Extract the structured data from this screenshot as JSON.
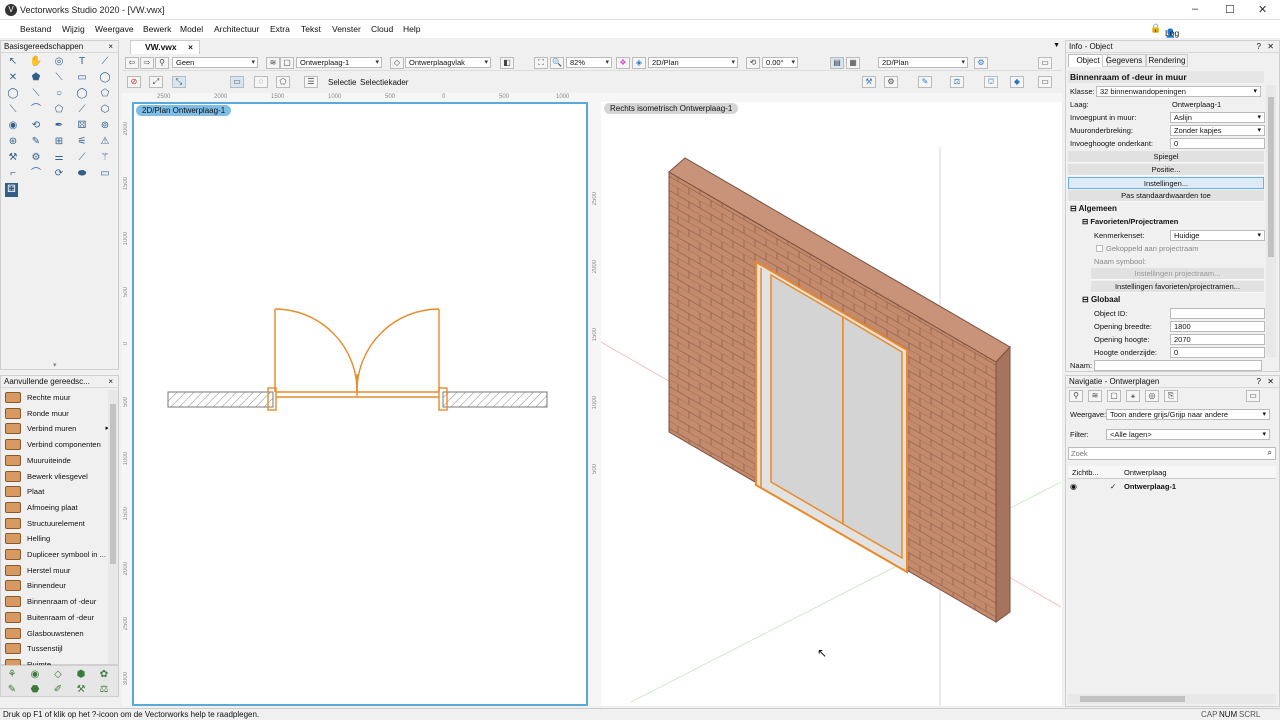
{
  "window": {
    "title": "Vectorworks Studio 2020 - [VW.vwx]",
    "app_icon": "V"
  },
  "menu": [
    "Bestand",
    "Wijzig",
    "Weergave",
    "Bewerk",
    "Model",
    "Architectuur",
    "Extra",
    "Tekst",
    "Venster",
    "Cloud",
    "Help"
  ],
  "login": "Log in",
  "tab": {
    "name": "VW.vwx",
    "close": "×"
  },
  "palette_basic": {
    "title": "Basisgereedschappen",
    "close": "×"
  },
  "palette_extra": {
    "title": "Aanvullende gereedsc...",
    "close": "×",
    "items": [
      "Rechte muur",
      "Ronde muur",
      "Verbind muren",
      "Verbind componenten",
      "Muuruiteinde",
      "Bewerk vliesgevel",
      "Plaat",
      "Afmoeing plaat",
      "Structuurelement",
      "Helling",
      "Dupliceer symbool in ...",
      "Herstel muur",
      "Binnendeur",
      "Binnenraam of -deur",
      "Buitenraam of -deur",
      "Glasbouwstenen",
      "Tussenstijl",
      "Ruimte"
    ]
  },
  "view_bar": {
    "class": "Geen",
    "layer": "Ontwerplaag-1",
    "plane": "Ontwerplaagvlak",
    "zoom": "82%",
    "view": "2D/Plan",
    "angle": "0.00°",
    "render": "2D/Plan"
  },
  "mode_bar": {
    "mode": "Selectie",
    "submode": "Selectiekader"
  },
  "ruler_top": [
    "2500",
    "2000",
    "1500",
    "1000",
    "500",
    "0",
    "500",
    "1000"
  ],
  "ruler_left": [
    "2000",
    "1500",
    "1000",
    "500",
    "0",
    "500",
    "1000",
    "1500",
    "2000",
    "2500",
    "3000"
  ],
  "ruler_left_right": [
    "2500",
    "2000",
    "1500",
    "1000",
    "500"
  ],
  "viewport_left": {
    "label": "2D/Plan  Ontwerplaag-1"
  },
  "viewport_right": {
    "label": "Rechts isometrisch  Ontwerplaag-1"
  },
  "info": {
    "title": "Info - Object",
    "tabs": [
      "Object",
      "Gegevens",
      "Rendering"
    ],
    "object_name": "Binnenraam of -deur in muur",
    "klasse_label": "Klasse:",
    "klasse": "32 binnenwandopeningen",
    "laag_label": "Laag:",
    "laag": "Ontwerplaag-1",
    "fields": [
      {
        "label": "Invoegpunt in muur:",
        "value": "Aslijn"
      },
      {
        "label": "Muuronderbreking:",
        "value": "Zonder kapjes"
      },
      {
        "label": "Invoeghoogte onderkant:",
        "value": "0"
      }
    ],
    "buttons": [
      "Spiegel",
      "Positie...",
      "Instellingen...",
      "Pas standaardwaarden toe"
    ],
    "algemeen": "Algemeen",
    "fav": "Favorieten/Projectramen",
    "kenmerkenset_label": "Kenmerkenset:",
    "kenmerkenset": "Huidige",
    "gekoppeld": "Gekoppeld aan projectraam",
    "naam_symbool": "Naam symbool:",
    "inst_proj": "Instellingen projectraam...",
    "inst_fav": "Instellingen favorieten/projectramen...",
    "globaal": "Globaal",
    "global_fields": [
      {
        "label": "Object ID:",
        "value": ""
      },
      {
        "label": "Opening breedte:",
        "value": "1800"
      },
      {
        "label": "Opening hoogte:",
        "value": "2070"
      },
      {
        "label": "Hoogte onderzijde:",
        "value": "0"
      }
    ],
    "naam_label": "Naam:"
  },
  "nav": {
    "title": "Navigatie - Ontwerplagen",
    "weergave_label": "Weergave:",
    "weergave": "Toon andere grijs/Grijp naar andere",
    "filter_label": "Filter:",
    "filter": "<Alle lagen>",
    "search_placeholder": "Zoek",
    "col1": "Zichtb...",
    "col2": "Ontwerplaag",
    "layer": "Ontwerplaag-1",
    "check": "✓"
  },
  "status": {
    "text": "Druk op F1 of klik op het ?-icoon om de Vectorworks help te raadplegen.",
    "caps": "CAP",
    "num": "NUM",
    "scrl": "SCRL"
  },
  "colors": {
    "accent": "#5aa9d9",
    "door": "#e88a2a",
    "brick": "#b87a5e",
    "selection": "#f07c1d"
  }
}
